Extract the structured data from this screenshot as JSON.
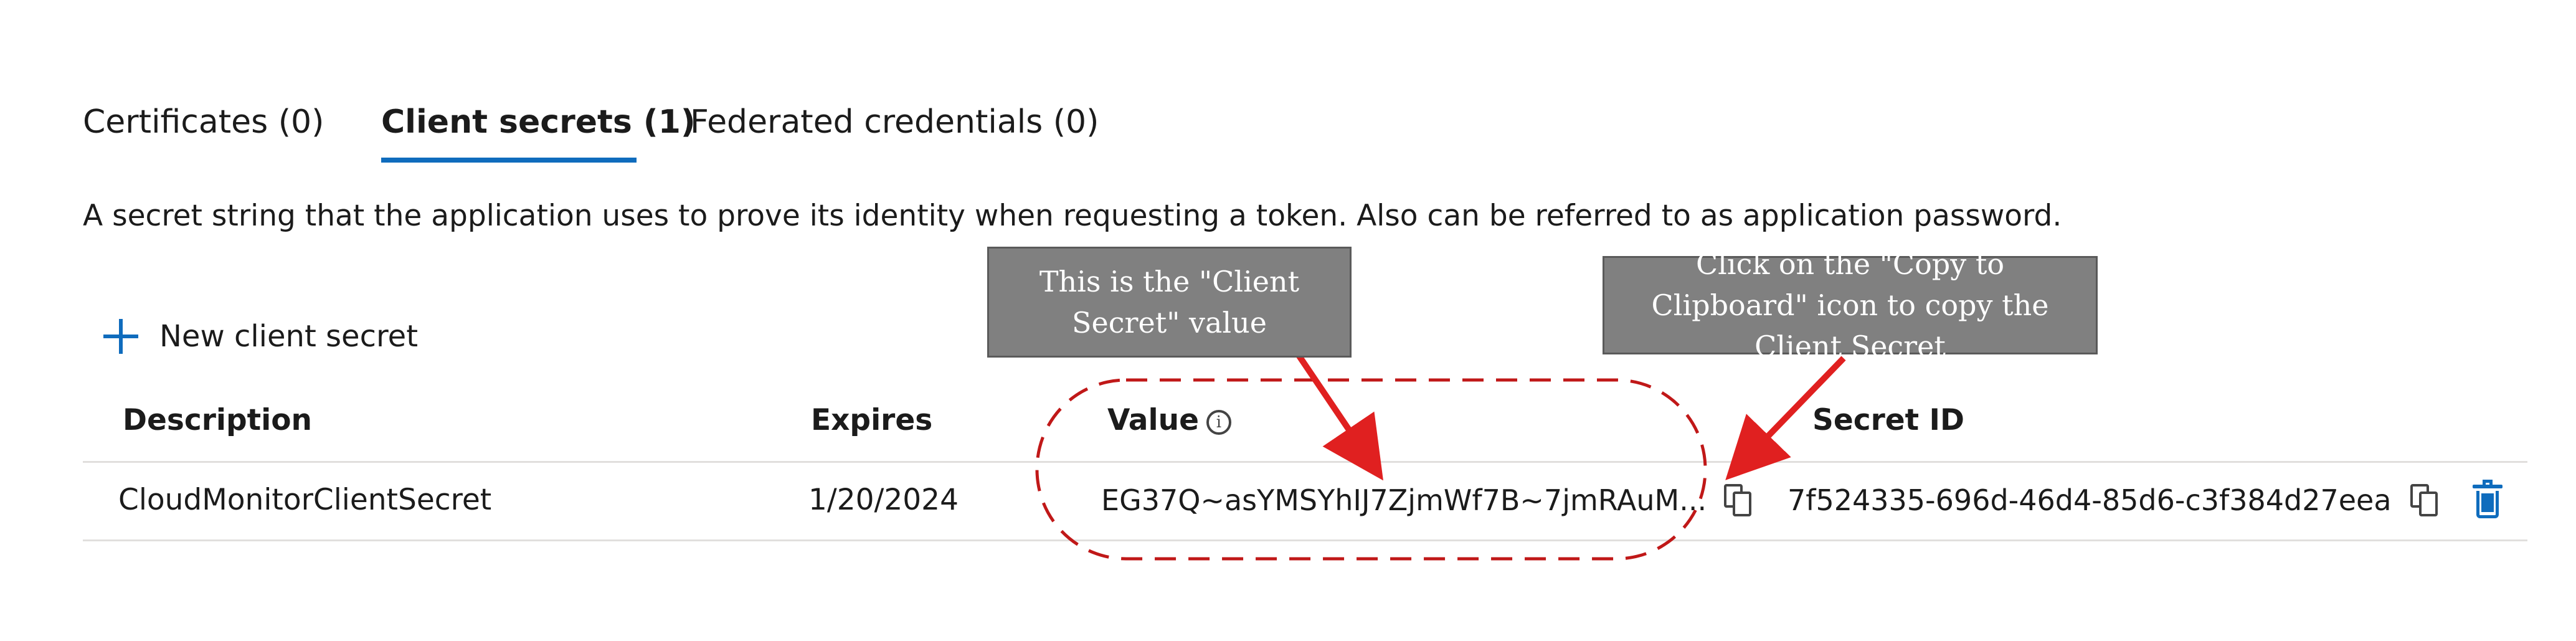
{
  "tabs": [
    {
      "label": "Certificates (0)",
      "active": false
    },
    {
      "label": "Client secrets (1)",
      "active": true
    },
    {
      "label": "Federated credentials (0)",
      "active": false
    }
  ],
  "description": "A secret string that the application uses to prove its identity when requesting a token. Also can be referred to as application password.",
  "toolbar": {
    "new_secret_label": "New client secret"
  },
  "table": {
    "columns": [
      "Description",
      "Expires",
      "Value",
      "Secret ID"
    ],
    "rows": [
      {
        "description": "CloudMonitorClientSecret",
        "expires": "1/20/2024",
        "value": "EG37Q~asYMSYhIJ7ZjmWf7B~7jmRAuM...",
        "secret_id": "7f524335-696d-46d4-85d6-c3f384d27eea"
      }
    ]
  },
  "annotations": {
    "callout_value": "This is the \"Client Secret\" value",
    "callout_copy": "Click on the \"Copy to Clipboard\" icon to copy the Client Secret"
  },
  "colors": {
    "accent": "#0f6cbd",
    "annotation_red": "#e02020",
    "callout_bg": "#808080"
  },
  "icons": [
    "plus-icon",
    "info-icon",
    "copy-icon",
    "trash-icon"
  ]
}
